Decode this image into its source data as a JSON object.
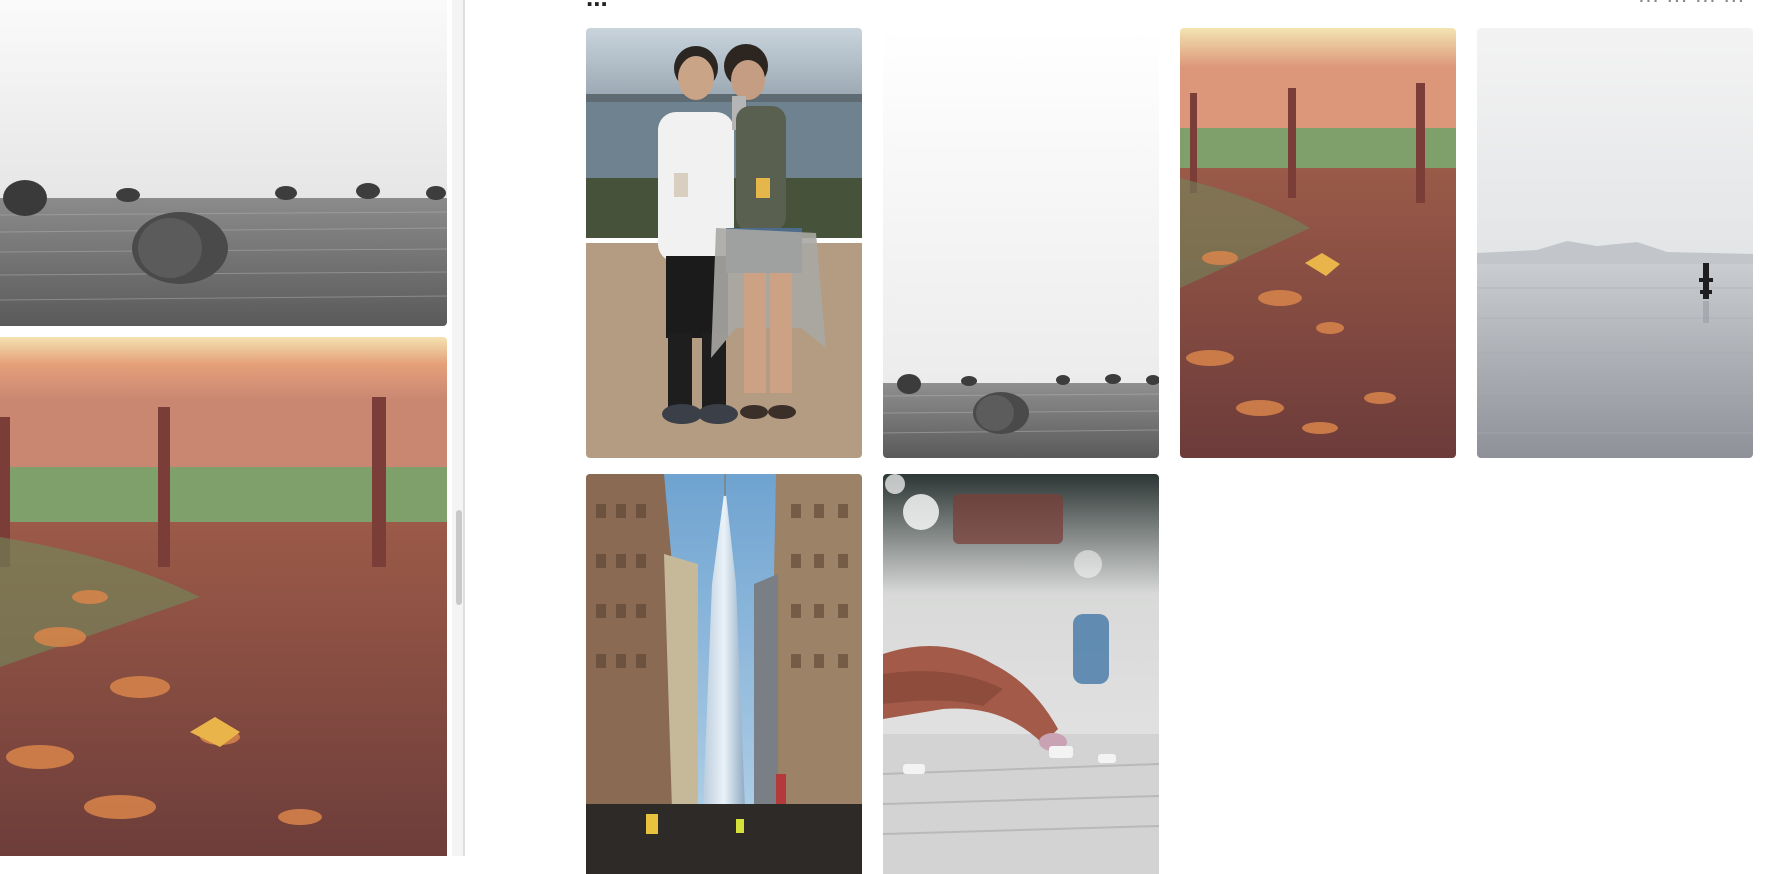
{
  "gallery": {
    "heading_fragment": "...",
    "right_header_fragment": "... ... ... ...",
    "photos": [
      {
        "subject": "couple selfie by the waterfront"
      },
      {
        "subject": "hay bales on black and white field"
      },
      {
        "subject": "autumn leaves on path by fence"
      },
      {
        "subject": "buoy on calm misty sea"
      },
      {
        "subject": "city street towards skyscraper"
      },
      {
        "subject": "hand on mixing console fader"
      }
    ]
  },
  "preview": {
    "photos": [
      {
        "subject": "hay bales on black and white field"
      },
      {
        "subject": "autumn leaves on path by fence"
      }
    ]
  },
  "colors": {
    "background": "#ffffff",
    "divider": "#dedede"
  }
}
